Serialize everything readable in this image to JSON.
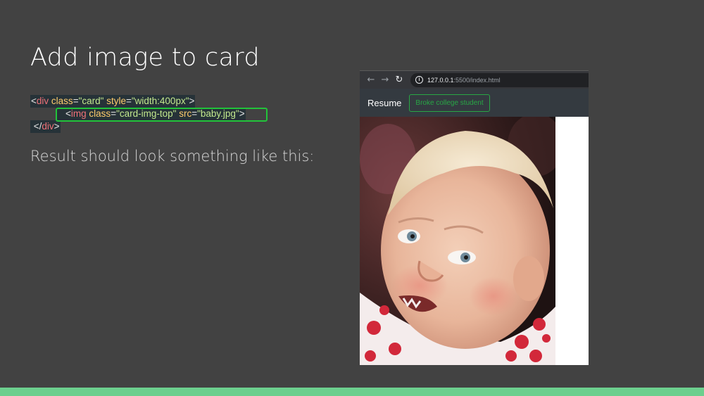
{
  "slide": {
    "title": "Add image to card",
    "subtitle": "Result should look something like this:"
  },
  "code": {
    "line1": {
      "open": "<",
      "tag": "div",
      "attr1": "class",
      "eq1": "=",
      "val1": "\"card\"",
      "attr2": "style",
      "eq2": "=",
      "val2": "\"width:400px\"",
      "close": ">"
    },
    "line2": {
      "open": "<",
      "tag": "img",
      "attr1": "class",
      "eq1": "=",
      "val1": "\"card-img-top\"",
      "attr2": "src",
      "eq2": "=",
      "val2": "\"baby.jpg\"",
      "close": ">"
    },
    "line3": {
      "open": "</",
      "tag": "div",
      "close": ">"
    }
  },
  "browser": {
    "url_host": "127.0.0.1",
    "url_rest": ":5500/index.html",
    "nav_back_icon": "arrow-left-icon",
    "nav_forward_icon": "arrow-right-icon",
    "reload_icon": "reload-icon",
    "info_icon": "info-icon"
  },
  "site": {
    "brand": "Resume",
    "button": "Broke college student"
  },
  "colors": {
    "background": "#424242",
    "accent_bar": "#6ccf8e",
    "highlight": "#22c33a",
    "button_green": "#28a745",
    "navbar": "#343a40"
  }
}
